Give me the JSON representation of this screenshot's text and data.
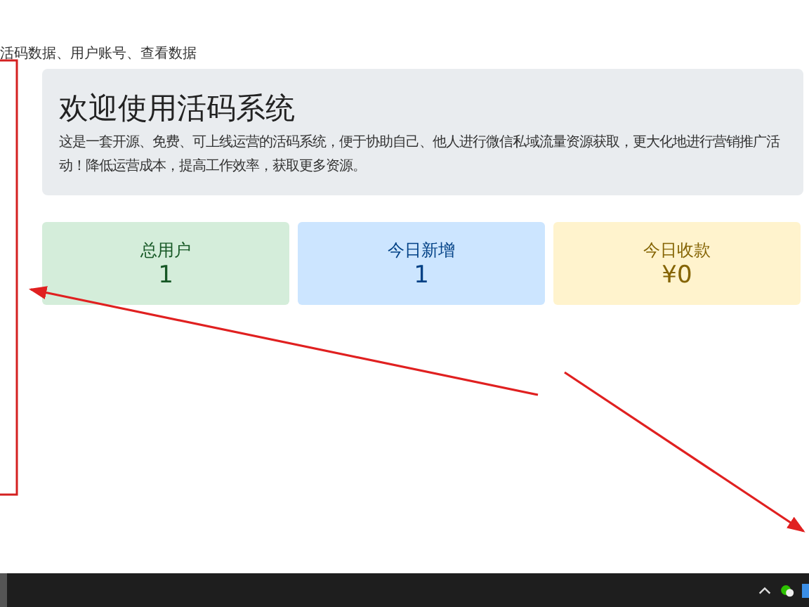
{
  "header_text": "活码数据、用户账号、查看数据",
  "welcome": {
    "title": "欢迎使用活码系统",
    "description": "这是一套开源、免费、可上线运营的活码系统，便于协助自己、他人进行微信私域流量资源获取，更大化地进行营销推广活动！降低运营成本，提高工作效率，获取更多资源。"
  },
  "stats": [
    {
      "label": "总用户",
      "value": "1",
      "color": "#d4edda"
    },
    {
      "label": "今日新增",
      "value": "1",
      "color": "#cce5ff"
    },
    {
      "label": "今日收款",
      "value": "¥0",
      "color": "#fff3cd"
    }
  ]
}
